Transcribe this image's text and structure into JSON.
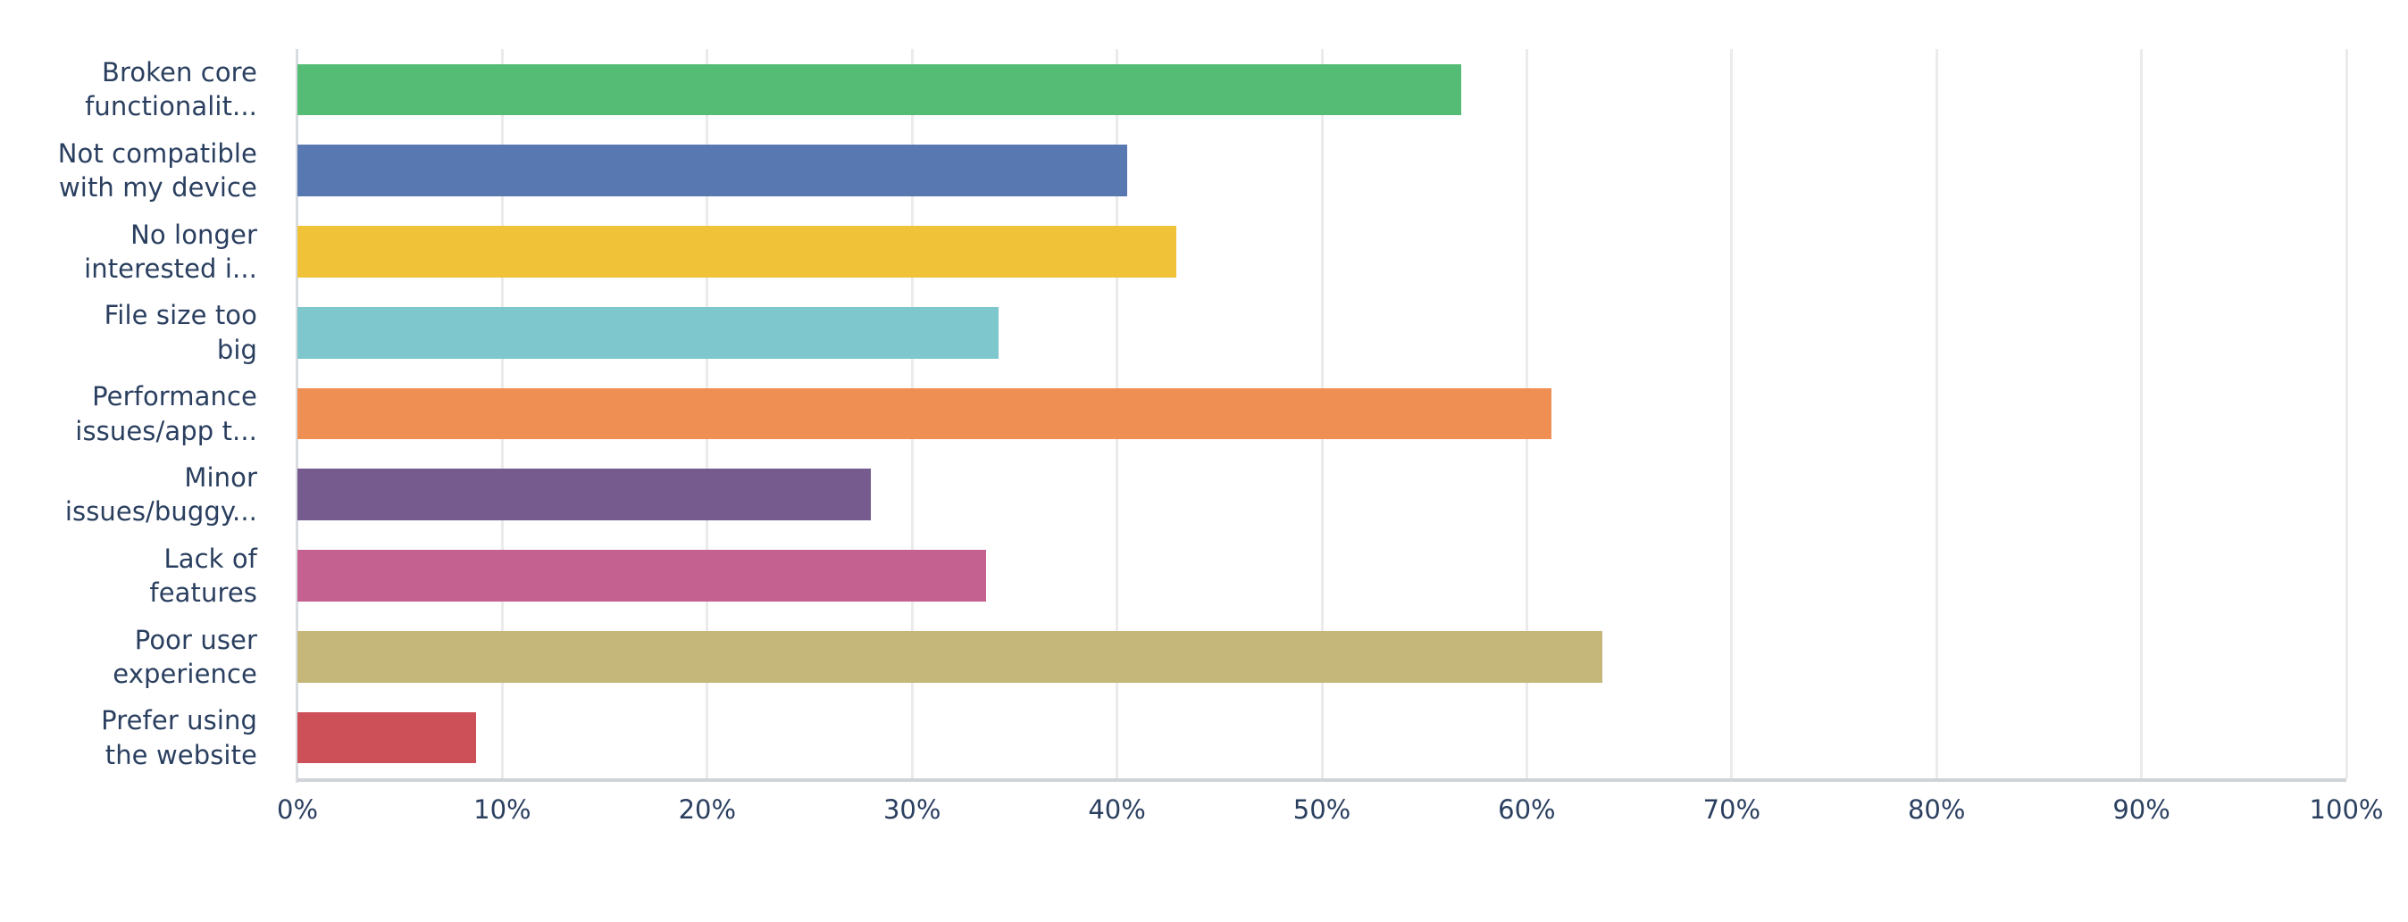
{
  "chart_data": {
    "type": "bar",
    "orientation": "horizontal",
    "title": "",
    "subtitle": "",
    "xlabel": "",
    "ylabel": "",
    "xlim": [
      0,
      100
    ],
    "grid": true,
    "legend": "none",
    "x_tick_labels": [
      "0%",
      "10%",
      "20%",
      "30%",
      "40%",
      "50%",
      "60%",
      "70%",
      "80%",
      "90%",
      "100%"
    ],
    "x_tick_values": [
      0,
      10,
      20,
      30,
      40,
      50,
      60,
      70,
      80,
      90,
      100
    ],
    "categories": [
      "Broken core\nfunctionalit...",
      "Not compatible\nwith my device",
      "No longer\ninterested i...",
      "File size too\nbig",
      "Performance\nissues/app t...",
      "Minor\nissues/buggy...",
      "Lack of\nfeatures",
      "Poor user\nexperience",
      "Prefer using\nthe website"
    ],
    "values": [
      56.8,
      40.5,
      42.9,
      34.2,
      61.2,
      28.0,
      33.6,
      63.7,
      8.7
    ],
    "value_labels": [
      "56.8%",
      "40.5%",
      "42.9%",
      "34.2%",
      "61.2%",
      "28.0%",
      "33.6%",
      "63.7%",
      "8.7%"
    ],
    "colors": [
      "#54bc74",
      "#5878b2",
      "#f0c237",
      "#7ec7cc",
      "#f08f53",
      "#765b8f",
      "#c56190",
      "#c5b679",
      "#cd5058"
    ],
    "bar_colors_named": [
      "green",
      "blue",
      "yellow",
      "teal",
      "orange",
      "purple",
      "pink",
      "tan",
      "red"
    ],
    "axis_text_color": "#2a3f5f",
    "gridline_color": "#ebebeb",
    "background_color": "#ffffff"
  }
}
